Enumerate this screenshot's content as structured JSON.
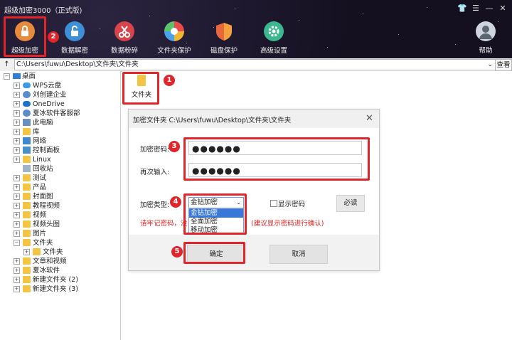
{
  "app": {
    "title": "超级加密3000（正式版)"
  },
  "window_controls": {
    "shirt": "👕",
    "menu": "☰",
    "minimize": "—",
    "close": "✕"
  },
  "toolbar": [
    {
      "label": "超级加密",
      "color": "#e88a3c"
    },
    {
      "label": "数据解密",
      "color": "#3d8fd8"
    },
    {
      "label": "数据粉碎",
      "color": "#d9434a"
    },
    {
      "label": "文件夹保护",
      "color": "#e9a23c"
    },
    {
      "label": "磁盘保护",
      "color": "#e8673c"
    },
    {
      "label": "高级设置",
      "color": "#3cb88e"
    },
    {
      "label": "帮助",
      "color": "#cfd5de"
    }
  ],
  "address": {
    "up": "↑",
    "path": "C:\\Users\\fuwu\\Desktop\\文件夹\\文件夹",
    "dropdown": "⌄",
    "view_button": "查看"
  },
  "tree": [
    {
      "label": "桌面",
      "icon": "desktop-icon"
    },
    {
      "label": "WPS云盘",
      "icon": "cloud-icon"
    },
    {
      "label": "刘创建企业",
      "icon": "user-icon"
    },
    {
      "label": "OneDrive",
      "icon": "cloud-icon"
    },
    {
      "label": "夏冰软件客服部",
      "icon": "user-icon"
    },
    {
      "label": "此电脑",
      "icon": "computer-icon"
    },
    {
      "label": "库",
      "icon": "library-icon"
    },
    {
      "label": "网络",
      "icon": "network-icon"
    },
    {
      "label": "控制面板",
      "icon": "control-panel-icon"
    },
    {
      "label": "Linux",
      "icon": "folder-icon"
    },
    {
      "label": "回收站",
      "icon": "recycle-bin-icon"
    },
    {
      "label": "测试",
      "icon": "folder-icon"
    },
    {
      "label": "产品",
      "icon": "folder-icon"
    },
    {
      "label": "封面图",
      "icon": "folder-icon"
    },
    {
      "label": "教程视频",
      "icon": "folder-icon"
    },
    {
      "label": "视频",
      "icon": "folder-icon"
    },
    {
      "label": "视频头图",
      "icon": "folder-icon"
    },
    {
      "label": "图片",
      "icon": "folder-icon"
    },
    {
      "label": "文件夹",
      "icon": "folder-icon"
    },
    {
      "label": "文件夹",
      "icon": "folder-icon"
    },
    {
      "label": "文章和视频",
      "icon": "folder-icon"
    },
    {
      "label": "夏冰软件",
      "icon": "folder-icon"
    },
    {
      "label": "新建文件夹 (2)",
      "icon": "folder-icon"
    },
    {
      "label": "新建文件夹 (3)",
      "icon": "folder-icon"
    }
  ],
  "content": {
    "folder_label": "文件夹"
  },
  "dialog": {
    "title": "加密文件夹 C:\\Users\\fuwu\\Desktop\\文件夹\\文件夹",
    "close": "✕",
    "password_label": "加密密码:",
    "password_value": "●●●●●●",
    "confirm_label": "再次输入:",
    "confirm_value": "●●●●●●",
    "type_label": "加密类型:",
    "type_selected": "金钻加密",
    "type_options": [
      "金钻加密",
      "全面加密",
      "移动加密"
    ],
    "show_password_label": "显示密码",
    "must_read": "必读",
    "warning_left": "请牢记密码，没",
    "warning_right": "(建议显示密码进行确认)",
    "ok": "确定",
    "cancel": "取消"
  },
  "steps": [
    "1",
    "2",
    "3",
    "4",
    "5"
  ],
  "colors": {
    "highlight": "#e0262a",
    "selection": "#3a78d8"
  }
}
